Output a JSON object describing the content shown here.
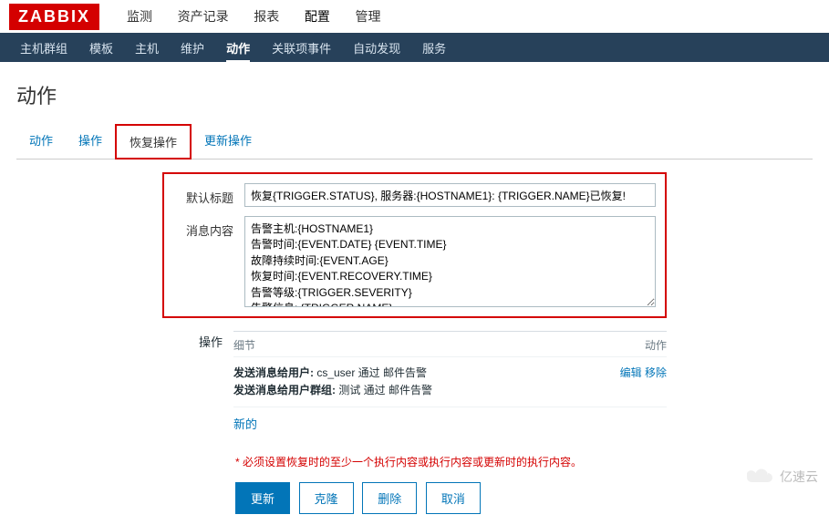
{
  "logo": "ZABBIX",
  "topnav": {
    "items": [
      "监测",
      "资产记录",
      "报表",
      "配置",
      "管理"
    ],
    "active": 3
  },
  "subnav": {
    "items": [
      "主机群组",
      "模板",
      "主机",
      "维护",
      "动作",
      "关联项事件",
      "自动发现",
      "服务"
    ],
    "active": 4
  },
  "page_title": "动作",
  "tabs": {
    "items": [
      "动作",
      "操作",
      "恢复操作",
      "更新操作"
    ],
    "outlined": 2
  },
  "form": {
    "subject_label": "默认标题",
    "subject_value": "恢复{TRIGGER.STATUS}, 服务器:{HOSTNAME1}: {TRIGGER.NAME}已恢复!",
    "message_label": "消息内容",
    "message_value": "告警主机:{HOSTNAME1}\n告警时间:{EVENT.DATE} {EVENT.TIME}\n故障持续时间:{EVENT.AGE}\n恢复时间:{EVENT.RECOVERY.TIME}\n告警等级:{TRIGGER.SEVERITY}\n告警信息: {TRIGGER.NAME}"
  },
  "ops": {
    "section_label": "操作",
    "col_detail": "细节",
    "col_action": "动作",
    "line1_prefix": "发送消息给用户:",
    "line1_rest": " cs_user 通过 邮件告警",
    "line2_prefix": "发送消息给用户群组:",
    "line2_rest": " 测试 通过 邮件告警",
    "edit": "编辑",
    "remove": "移除",
    "new": "新的"
  },
  "req_note": "必须设置恢复时的至少一个执行内容或执行内容或更新时的执行内容。",
  "buttons": {
    "update": "更新",
    "clone": "克隆",
    "delete": "删除",
    "cancel": "取消"
  },
  "watermark": "亿速云"
}
